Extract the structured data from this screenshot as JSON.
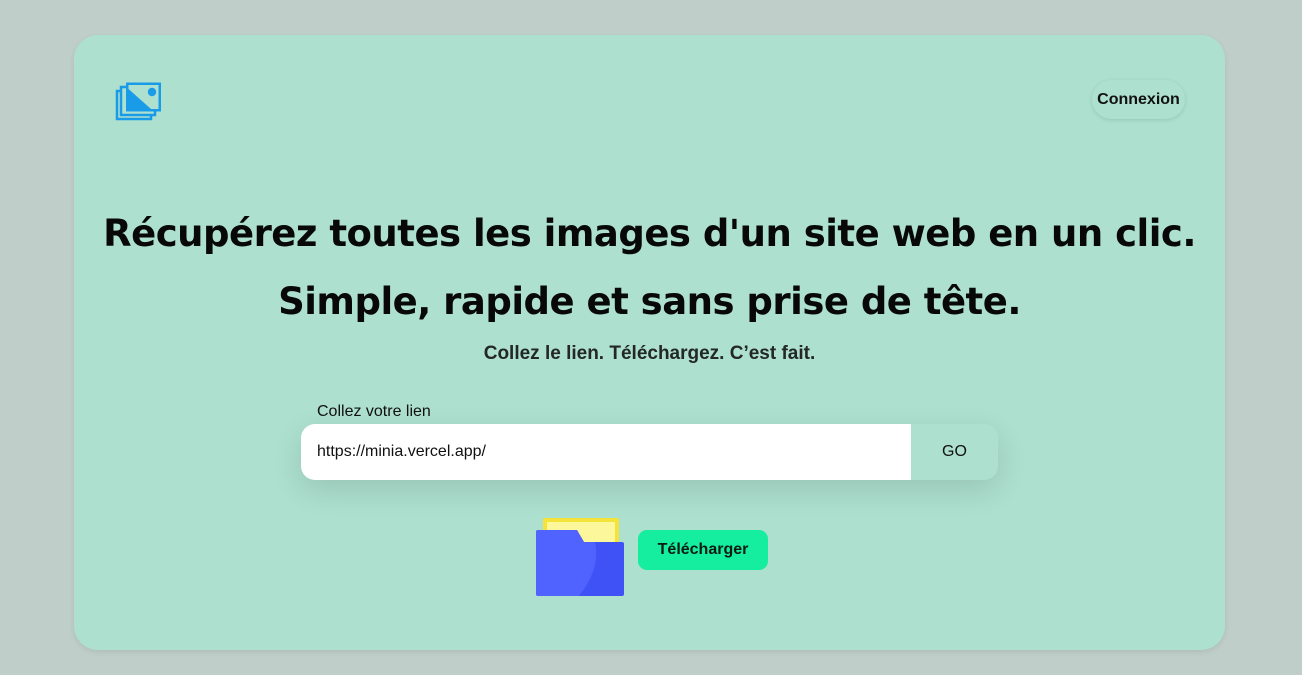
{
  "header": {
    "logo_icon": "images-stack-icon",
    "login_label": "Connexion"
  },
  "hero": {
    "headline_line1": "Récupérez toutes les images d'un site web en un clic.",
    "headline_line2": "Simple, rapide et sans prise de tête.",
    "subtitle": "Collez le lien. Téléchargez. C’est fait."
  },
  "form": {
    "label": "Collez votre lien",
    "url_value": "https://minia.vercel.app/",
    "go_label": "GO"
  },
  "download": {
    "icon": "folder-icon",
    "button_label": "Télécharger"
  },
  "colors": {
    "page_background": "#bfcec9",
    "card_background": "#ade0cf",
    "logo_blue": "#1a9be8",
    "download_button": "#15ee9e",
    "folder_blue": "#4a5ef7",
    "folder_yellow": "#f4e33a"
  }
}
